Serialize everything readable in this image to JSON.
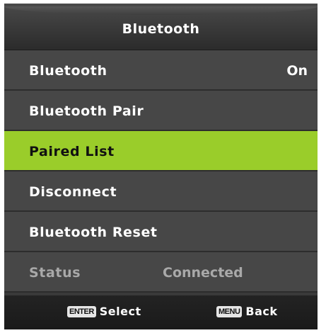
{
  "header": {
    "title": "Bluetooth"
  },
  "menu": {
    "items": [
      {
        "label": "Bluetooth",
        "value": "On"
      },
      {
        "label": "Bluetooth Pair"
      },
      {
        "label": "Paired List"
      },
      {
        "label": "Disconnect"
      },
      {
        "label": "Bluetooth Reset"
      },
      {
        "label": "Status",
        "value": "Connected"
      }
    ],
    "selected_index": 2
  },
  "footer": {
    "enter": {
      "key": "ENTER",
      "label": "Select"
    },
    "menu": {
      "key": "MENU",
      "label": "Back"
    }
  },
  "colors": {
    "highlight": "#9acd2a",
    "panel": "#474747",
    "disabled_text": "#a9a9a9"
  }
}
